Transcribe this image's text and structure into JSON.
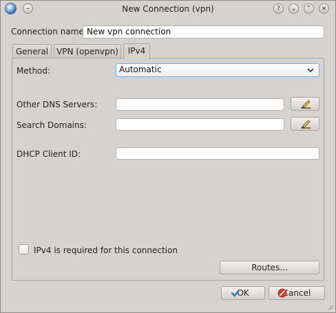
{
  "window": {
    "title": "New Connection (vpn)",
    "title_buttons": {
      "help": "?",
      "minimize": "⌄",
      "maximize": "⌃",
      "close": "×"
    }
  },
  "connection": {
    "name_label": "Connection name:",
    "name_value": "New vpn connection"
  },
  "tabs": [
    {
      "label": "General",
      "active": false
    },
    {
      "label": "VPN (openvpn)",
      "active": false
    },
    {
      "label": "IPv4",
      "active": true
    }
  ],
  "ipv4": {
    "method_label": "Method:",
    "method_value": "Automatic",
    "dns_label": "Other DNS Servers:",
    "dns_value": "",
    "search_label": "Search Domains:",
    "search_value": "",
    "dhcp_label": "DHCP Client ID:",
    "dhcp_value": "",
    "required_label": "IPv4 is required for this connection",
    "required_checked": false,
    "routes_label": "Routes..."
  },
  "dialog_buttons": {
    "ok_label": "OK",
    "cancel_label": "Cancel"
  },
  "colors": {
    "window_bg": "#d6d2d0",
    "focus_border": "#78aee2",
    "ok_check": "#3b73c4",
    "cancel_icon": "#d23b2b"
  },
  "icons": {
    "app": "network-globe-icon",
    "edit": "pencil-edit-icon",
    "ok": "checkmark-icon",
    "cancel": "cancel-circle-icon"
  }
}
